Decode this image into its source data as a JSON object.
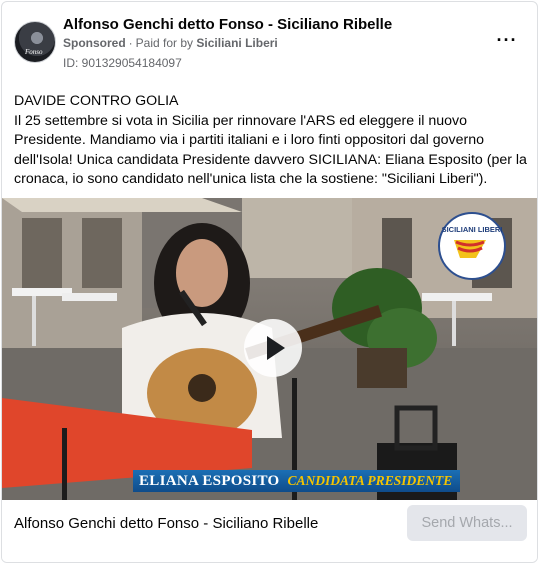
{
  "header": {
    "page_name": "Alfonso Genchi detto Fonso - Siciliano Ribelle",
    "sponsored_label": "Sponsored",
    "separator": "·",
    "paid_prefix": "Paid for by",
    "paid_by": "Siciliani Liberi",
    "ad_id": "ID: 901329054184097",
    "more_options": "···",
    "avatar_tag": "Fonso"
  },
  "post": {
    "headline": "DAVIDE CONTRO GOLIA",
    "body": "Il 25 settembre si vota in Sicilia per rinnovare l'ARS ed eleggere il nuovo Presidente. Mandiamo via i partiti italiani e i loro finti oppositori dal governo dell'Isola! Unica candidata Presidente davvero SICILIANA: Eliana Esposito (per la cronaca, io sono candidato nell'unica lista che la sostiene: \"Siciliani Liberi\")."
  },
  "video": {
    "caption_name": "ELIANA ESPOSITO",
    "caption_role": "CANDIDATA PRESIDENTE",
    "logo_text": "SICILIANI LIBERI",
    "play_icon": "play-icon"
  },
  "footer": {
    "title": "Alfonso Genchi detto Fonso - Siciliano Ribelle",
    "cta_label": "Send Whats..."
  },
  "colors": {
    "caption_bar": "#1b6fb5",
    "caption_role": "#f5c400",
    "cta_bg": "#e4e6eb",
    "cta_text": "#a5a8ad"
  }
}
